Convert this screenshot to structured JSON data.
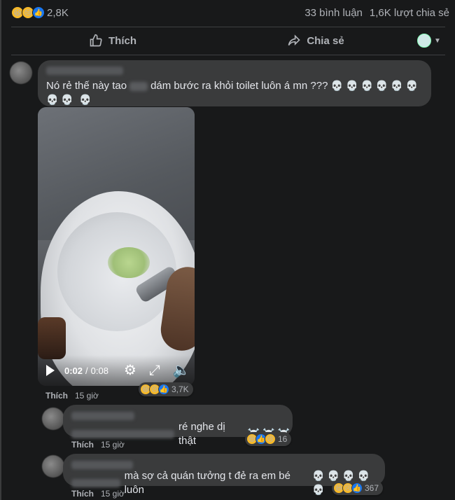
{
  "post_stats": {
    "reaction_count": "2,8K",
    "comments": "33 bình luận",
    "shares": "1,6K lượt chia sẻ"
  },
  "actions": {
    "like_label": "Thích",
    "share_label": "Chia sẻ"
  },
  "comments": [
    {
      "text_before": "Nó rẻ thế này tao",
      "text_after": "dám bước ra khỏi toilet luôn á mn ???",
      "emoji": "💀💀💀💀💀💀💀💀",
      "emoji_wrap": "💀",
      "video": {
        "current_time": "0:02",
        "separator": "/",
        "duration": "0:08"
      },
      "reaction_count": "3,7K",
      "like_label": "Thích",
      "time": "15 giờ"
    },
    {
      "text": "ré nghe dị thật",
      "emoji": "☠️☠️☠️",
      "reaction_count": "16",
      "like_label": "Thích",
      "time": "15 giờ"
    },
    {
      "text": "mà sợ cả quán tưởng t đẻ ra em bé luôn",
      "emoji": "💀💀💀💀💀",
      "reaction_count": "367",
      "like_label": "Thích",
      "time": "15 giờ"
    }
  ],
  "colors": {
    "background": "#18191a",
    "bubble": "#3a3b3c",
    "text": "#e4e6eb",
    "muted": "#b0b3b8",
    "like_blue": "#1877f2",
    "haha_yellow": "#f7b928"
  }
}
